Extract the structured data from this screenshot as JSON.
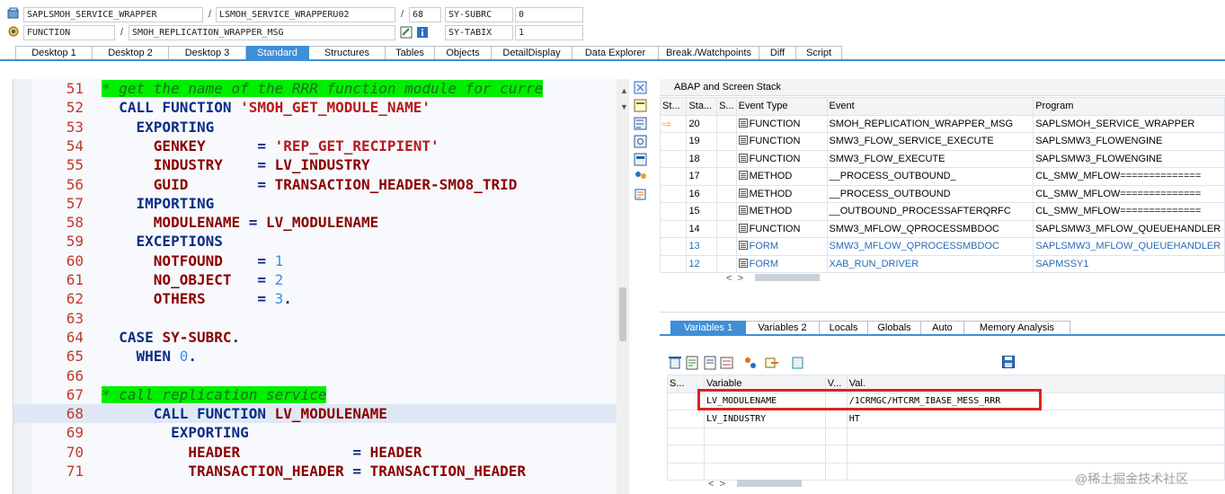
{
  "info": {
    "program": "SAPLSMOH_SERVICE_WRAPPER",
    "include": "LSMOH_SERVICE_WRAPPERU02",
    "line": "68",
    "subrc_label": "SY-SUBRC",
    "subrc_value": "0",
    "type": "FUNCTION",
    "name": "SMOH_REPLICATION_WRAPPER_MSG",
    "tabix_label": "SY-TABIX",
    "tabix_value": "1"
  },
  "tabs": [
    "Desktop 1",
    "Desktop 2",
    "Desktop 3",
    "Standard",
    "Structures",
    "Tables",
    "Objects",
    "DetailDisplay",
    "Data Explorer",
    "Break./Watchpoints",
    "Diff",
    "Script"
  ],
  "active_tab": "Standard",
  "code_lines": [
    {
      "n": "51",
      "text": "* get the name of the RRR function module for curre"
    },
    {
      "n": "52",
      "text": "  CALL FUNCTION 'SMOH_GET_MODULE_NAME'"
    },
    {
      "n": "53",
      "text": "    EXPORTING"
    },
    {
      "n": "54",
      "text": "      GENKEY      = 'REP_GET_RECIPIENT'"
    },
    {
      "n": "55",
      "text": "      INDUSTRY    = LV_INDUSTRY"
    },
    {
      "n": "56",
      "text": "      GUID        = TRANSACTION_HEADER-SMO8_TRID"
    },
    {
      "n": "57",
      "text": "    IMPORTING"
    },
    {
      "n": "58",
      "text": "      MODULENAME = LV_MODULENAME"
    },
    {
      "n": "59",
      "text": "    EXCEPTIONS"
    },
    {
      "n": "60",
      "text": "      NOTFOUND    = 1"
    },
    {
      "n": "61",
      "text": "      NO_OBJECT   = 2"
    },
    {
      "n": "62",
      "text": "      OTHERS      = 3."
    },
    {
      "n": "63",
      "text": ""
    },
    {
      "n": "64",
      "text": "  CASE SY-SUBRC."
    },
    {
      "n": "65",
      "text": "    WHEN 0."
    },
    {
      "n": "66",
      "text": ""
    },
    {
      "n": "67",
      "text": "* call replication service"
    },
    {
      "n": "68",
      "text": "      CALL FUNCTION LV_MODULENAME"
    },
    {
      "n": "69",
      "text": "        EXPORTING"
    },
    {
      "n": "70",
      "text": "          HEADER             = HEADER"
    },
    {
      "n": "71",
      "text": "          TRANSACTION_HEADER = TRANSACTION_HEADER"
    }
  ],
  "stack": {
    "title": "ABAP and Screen Stack",
    "columns": [
      "St...",
      "Sta...",
      "S...",
      "Event Type",
      "Event",
      "Program"
    ],
    "rows": [
      {
        "level": "20",
        "type": "FUNCTION",
        "event": "SMOH_REPLICATION_WRAPPER_MSG",
        "program": "SAPLSMOH_SERVICE_WRAPPER",
        "current": true
      },
      {
        "level": "19",
        "type": "FUNCTION",
        "event": "SMW3_FLOW_SERVICE_EXECUTE",
        "program": "SAPLSMW3_FLOWENGINE"
      },
      {
        "level": "18",
        "type": "FUNCTION",
        "event": "SMW3_FLOW_EXECUTE",
        "program": "SAPLSMW3_FLOWENGINE"
      },
      {
        "level": "17",
        "type": "METHOD",
        "event": "__PROCESS_OUTBOUND_",
        "program": "CL_SMW_MFLOW=============="
      },
      {
        "level": "16",
        "type": "METHOD",
        "event": "__PROCESS_OUTBOUND",
        "program": "CL_SMW_MFLOW=============="
      },
      {
        "level": "15",
        "type": "METHOD",
        "event": "__OUTBOUND_PROCESSAFTERQRFC",
        "program": "CL_SMW_MFLOW=============="
      },
      {
        "level": "14",
        "type": "FUNCTION",
        "event": "SMW3_MFLOW_QPROCESSMBDOC",
        "program": "SAPLSMW3_MFLOW_QUEUEHANDLER"
      },
      {
        "level": "13",
        "type": "FORM",
        "event": "SMW3_MFLOW_QPROCESSMBDOC",
        "program": "SAPLSMW3_MFLOW_QUEUEHANDLER",
        "blue": true
      },
      {
        "level": "12",
        "type": "FORM",
        "event": "XAB_RUN_DRIVER",
        "program": "SAPMSSY1",
        "blue": true
      }
    ]
  },
  "var_tabs": [
    "Variables 1",
    "Variables 2",
    "Locals",
    "Globals",
    "Auto",
    "Memory Analysis"
  ],
  "active_var_tab": "Variables 1",
  "variables": {
    "columns": [
      "S...",
      "Variable",
      "V...",
      "Val."
    ],
    "rows": [
      {
        "name": "LV_MODULENAME",
        "value": "/1CRMGC/HTCRM_IBASE_MESS_RRR"
      },
      {
        "name": "LV_INDUSTRY",
        "value": "HT"
      }
    ]
  },
  "scroll_arrows": "< >",
  "watermark": "@稀土掘金技术社区",
  "colors": {
    "accent": "#3f8fd8",
    "highlight_box": "#e02020",
    "comment_bg": "#00ee00"
  }
}
